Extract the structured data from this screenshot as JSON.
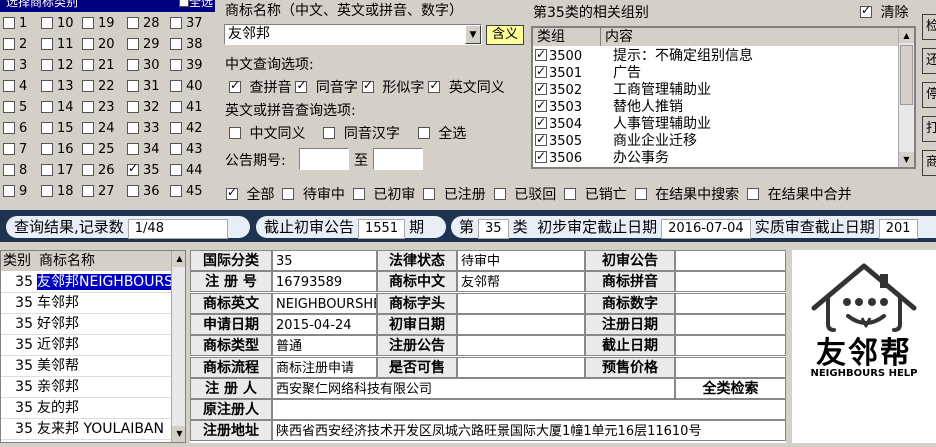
{
  "class_panel": {
    "title": "选择商标类别",
    "select_all": "全选",
    "classes": [
      "1",
      "2",
      "3",
      "4",
      "5",
      "6",
      "7",
      "8",
      "9",
      "10",
      "11",
      "12",
      "13",
      "14",
      "15",
      "16",
      "17",
      "18",
      "19",
      "20",
      "21",
      "22",
      "23",
      "24",
      "25",
      "26",
      "27",
      "28",
      "29",
      "30",
      "31",
      "32",
      "33",
      "34",
      "35",
      "36",
      "37",
      "38",
      "39",
      "40",
      "41",
      "42",
      "43",
      "44",
      "45"
    ],
    "checked": [
      "35"
    ]
  },
  "search": {
    "name_label": "商标名称（中文、英文或拼音、数字）",
    "name_value": "友邻邦",
    "hanyi_button": "含义",
    "chinese_options_label": "中文查询选项:",
    "chinese_options": [
      {
        "label": "查拼音",
        "checked": true
      },
      {
        "label": "同音字",
        "checked": true
      },
      {
        "label": "形似字",
        "checked": true
      },
      {
        "label": "英文同义",
        "checked": true
      }
    ],
    "english_options_label": "英文或拼音查询选项:",
    "english_options": [
      {
        "label": "中文同义",
        "checked": false
      },
      {
        "label": "同音汉字",
        "checked": false
      },
      {
        "label": "全选",
        "checked": false
      }
    ],
    "gazette_label": "公告期号:",
    "gazette_to": "至"
  },
  "groups": {
    "title": "第35类的相关组别",
    "clear_label": "清除",
    "clear_checked": true,
    "col_group": "类组",
    "col_content": "内容",
    "rows": [
      {
        "code": "3500",
        "content": "提示：不确定组别信息"
      },
      {
        "code": "3501",
        "content": "广告"
      },
      {
        "code": "3502",
        "content": "工商管理辅助业"
      },
      {
        "code": "3503",
        "content": "替他人推销"
      },
      {
        "code": "3504",
        "content": "人事管理辅助业"
      },
      {
        "code": "3505",
        "content": "商业企业迁移"
      },
      {
        "code": "3506",
        "content": "办公事务"
      }
    ]
  },
  "side_buttons": [
    "检",
    "还",
    "停",
    "打",
    "商"
  ],
  "filters": [
    {
      "label": "全部",
      "checked": true
    },
    {
      "label": "待审中",
      "checked": false
    },
    {
      "label": "已初审",
      "checked": false
    },
    {
      "label": "已注册",
      "checked": false
    },
    {
      "label": "已驳回",
      "checked": false
    },
    {
      "label": "已销亡",
      "checked": false
    },
    {
      "label": "在结果中搜索",
      "checked": false
    },
    {
      "label": "在结果中合并",
      "checked": false
    }
  ],
  "status": {
    "result_label": "查询结果,记录数",
    "result_value": "1/48",
    "deadline_label": "截止初审公告",
    "deadline_value": "1551",
    "deadline_unit": "期",
    "class_prefix": "第",
    "class_value": "35",
    "class_suffix": "类",
    "prelim_label": "初步审定截止日期",
    "prelim_value": "2016-07-04",
    "substantive_label": "实质审查截止日期",
    "substantive_value": "201"
  },
  "results": {
    "col_class": "类别",
    "col_name": "商标名称",
    "rows": [
      {
        "cls": "35",
        "name": "友邻邦NEIGHBOURS"
      },
      {
        "cls": "35",
        "name": "车邻邦"
      },
      {
        "cls": "35",
        "name": "好邻邦"
      },
      {
        "cls": "35",
        "name": "近邻邦"
      },
      {
        "cls": "35",
        "name": "美邻帮"
      },
      {
        "cls": "35",
        "name": "亲邻邦"
      },
      {
        "cls": "35",
        "name": "友的邦"
      },
      {
        "cls": "35",
        "name": "友来邦 YOULAIBAN"
      }
    ]
  },
  "detail": {
    "intl_class_label": "国际分类",
    "intl_class": "35",
    "legal_status_label": "法律状态",
    "legal_status": "待审中",
    "prelim_gazette_label": "初审公告",
    "reg_no_label": "注 册 号",
    "reg_no": "16793589",
    "name_cn_label": "商标中文",
    "name_cn": "友邻帮",
    "pinyin_label": "商标拼音",
    "name_en_label": "商标英文",
    "name_en": "NEIGHBOURSHEI",
    "initial_label": "商标字头",
    "digits_label": "商标数字",
    "apply_date_label": "申请日期",
    "apply_date": "2015-04-24",
    "prelim_date_label": "初审日期",
    "reg_date_label": "注册日期",
    "type_label": "商标类型",
    "type": "普通",
    "reg_gazette_label": "注册公告",
    "expire_label": "截止日期",
    "flow_label": "商标流程",
    "flow": "商标注册申请",
    "sellable_label": "是否可售",
    "price_label": "预售价格",
    "registrant_label": "注 册 人",
    "registrant": "西安聚仁网络科技有限公司",
    "search_all": "全类检索",
    "orig_registrant_label": "原注册人",
    "address_label": "注册地址",
    "address": "陕西省西安经济技术开发区凤城六路旺景国际大厦1幢1单元16层11610号"
  },
  "logo": {
    "text_cn": "友邻帮",
    "text_en": "NEIGHBOURS HELP"
  }
}
